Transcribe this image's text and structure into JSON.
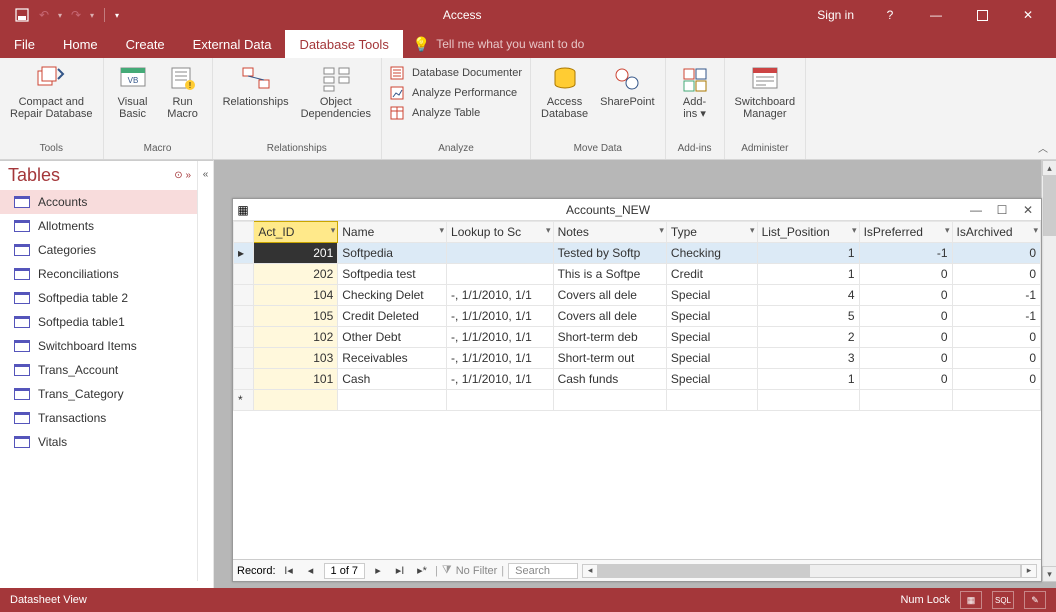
{
  "titlebar": {
    "title": "Access",
    "signin": "Sign in"
  },
  "tabs": {
    "items": [
      "File",
      "Home",
      "Create",
      "External Data",
      "Database Tools"
    ],
    "active": 4,
    "tell_me": "Tell me what you want to do"
  },
  "ribbon": {
    "groups": {
      "tools": {
        "label": "Tools",
        "compact": "Compact and\nRepair Database"
      },
      "macro": {
        "label": "Macro",
        "vb": "Visual\nBasic",
        "run": "Run\nMacro"
      },
      "relationships": {
        "label": "Relationships",
        "rel": "Relationships",
        "dep": "Object\nDependencies"
      },
      "analyze": {
        "label": "Analyze",
        "doc": "Database Documenter",
        "perf": "Analyze Performance",
        "table": "Analyze Table"
      },
      "move": {
        "label": "Move Data",
        "access": "Access\nDatabase",
        "sharepoint": "SharePoint"
      },
      "addins": {
        "label": "Add-ins",
        "btn": "Add-\nins ▾"
      },
      "admin": {
        "label": "Administer",
        "btn": "Switchboard\nManager"
      }
    }
  },
  "nav": {
    "header": "Tables",
    "items": [
      "Accounts",
      "Allotments",
      "Categories",
      "Reconciliations",
      "Softpedia table 2",
      "Softpedia table1",
      "Switchboard Items",
      "Trans_Account",
      "Trans_Category",
      "Transactions",
      "Vitals"
    ],
    "selected": 0
  },
  "docwin": {
    "title": "Accounts_NEW",
    "columns": [
      "Act_ID",
      "Name",
      "Lookup to Sc",
      "Notes",
      "Type",
      "List_Position",
      "IsPreferred",
      "IsArchived"
    ],
    "rows": [
      {
        "id": "201",
        "name": "Softpedia",
        "lookup": "",
        "notes": "Tested by Softp",
        "type": "Checking",
        "pos": "1",
        "pref": "-1",
        "arch": "0"
      },
      {
        "id": "202",
        "name": "Softpedia test",
        "lookup": "",
        "notes": "This is a Softpe",
        "type": "Credit",
        "pos": "1",
        "pref": "0",
        "arch": "0"
      },
      {
        "id": "104",
        "name": "Checking Delet",
        "lookup": "-, 1/1/2010, 1/1",
        "notes": "Covers all dele",
        "type": "Special",
        "pos": "4",
        "pref": "0",
        "arch": "-1"
      },
      {
        "id": "105",
        "name": "Credit Deleted",
        "lookup": "-, 1/1/2010, 1/1",
        "notes": "Covers all dele",
        "type": "Special",
        "pos": "5",
        "pref": "0",
        "arch": "-1"
      },
      {
        "id": "102",
        "name": "Other Debt",
        "lookup": "-, 1/1/2010, 1/1",
        "notes": "Short-term deb",
        "type": "Special",
        "pos": "2",
        "pref": "0",
        "arch": "0"
      },
      {
        "id": "103",
        "name": "Receivables",
        "lookup": "-, 1/1/2010, 1/1",
        "notes": "Short-term out",
        "type": "Special",
        "pos": "3",
        "pref": "0",
        "arch": "0"
      },
      {
        "id": "101",
        "name": "Cash",
        "lookup": "-, 1/1/2010, 1/1",
        "notes": "Cash funds",
        "type": "Special",
        "pos": "1",
        "pref": "0",
        "arch": "0"
      }
    ],
    "record_label": "Record:",
    "record_pos": "1 of 7",
    "no_filter": "No Filter",
    "search": "Search"
  },
  "status": {
    "view": "Datasheet View",
    "numlock": "Num Lock"
  }
}
